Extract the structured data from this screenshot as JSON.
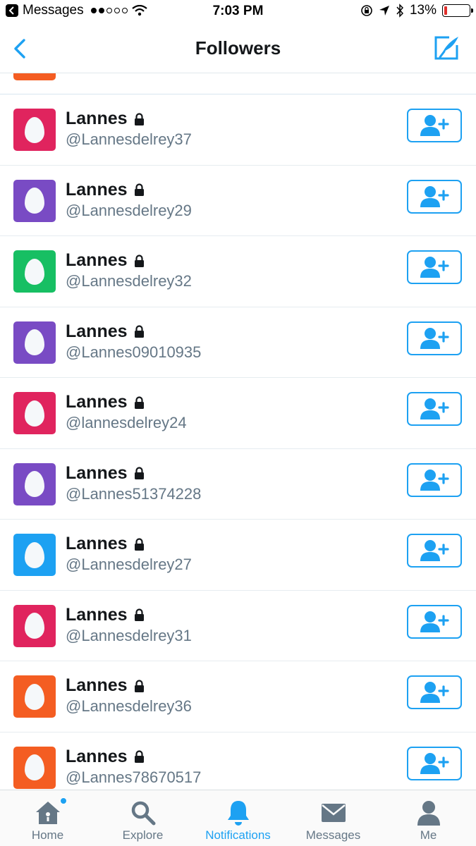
{
  "status_bar": {
    "back_app": "Messages",
    "time": "7:03 PM",
    "battery": "13%",
    "battery_level": 0.13,
    "signal_bars_filled": 2,
    "signal_bars_total": 5
  },
  "nav": {
    "title": "Followers",
    "back_icon": "chevron-left-icon",
    "compose_icon": "compose-tweet-icon"
  },
  "partial_row": {
    "avatar_color": "#f45d22"
  },
  "followers": [
    {
      "name": "Lannes",
      "handle": "@Lannesdelrey37",
      "avatar_color": "#e0245e"
    },
    {
      "name": "Lannes",
      "handle": "@Lannesdelrey29",
      "avatar_color": "#794bc4"
    },
    {
      "name": "Lannes",
      "handle": "@Lannesdelrey32",
      "avatar_color": "#17bf63"
    },
    {
      "name": "Lannes",
      "handle": "@Lannes09010935",
      "avatar_color": "#794bc4"
    },
    {
      "name": "Lannes",
      "handle": "@lannesdelrey24",
      "avatar_color": "#e0245e"
    },
    {
      "name": "Lannes",
      "handle": "@Lannes51374228",
      "avatar_color": "#794bc4"
    },
    {
      "name": "Lannes",
      "handle": "@Lannesdelrey27",
      "avatar_color": "#1da1f2"
    },
    {
      "name": "Lannes",
      "handle": "@Lannesdelrey31",
      "avatar_color": "#e0245e"
    },
    {
      "name": "Lannes",
      "handle": "@Lannesdelrey36",
      "avatar_color": "#f45d22"
    },
    {
      "name": "Lannes",
      "handle": "@Lannes78670517",
      "avatar_color": "#f45d22"
    }
  ],
  "tabs": [
    {
      "label": "Home",
      "icon": "home-icon",
      "active": false,
      "badge": true
    },
    {
      "label": "Explore",
      "icon": "search-icon",
      "active": false,
      "badge": false
    },
    {
      "label": "Notifications",
      "icon": "bell-icon",
      "active": true,
      "badge": false
    },
    {
      "label": "Messages",
      "icon": "envelope-icon",
      "active": false,
      "badge": false
    },
    {
      "label": "Me",
      "icon": "person-icon",
      "active": false,
      "badge": false
    }
  ],
  "colors": {
    "accent": "#1da1f2",
    "text_primary": "#14171a",
    "text_secondary": "#657786"
  }
}
